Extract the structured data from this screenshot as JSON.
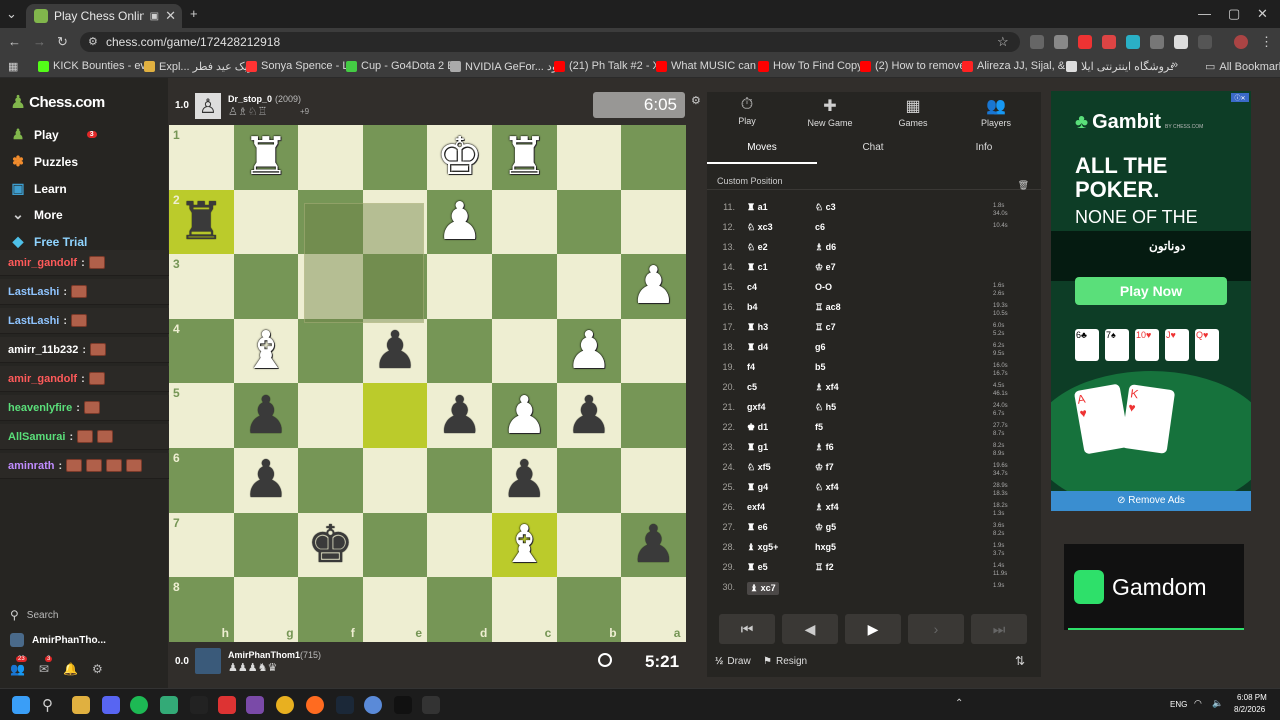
{
  "browser": {
    "tab_title": "Play Chess Online for FREE",
    "url": "chess.com/game/172428212918",
    "bookmarks": [
      {
        "label": "KICK Bounties - eve...",
        "color": "#53fc18"
      },
      {
        "label": "Expl... تبریک عید فطر",
        "color": "#e0b040"
      },
      {
        "label": "Sonya Spence - Let...",
        "color": "#ff3333"
      },
      {
        "label": "Cup - Go4Dota 2 Eu...",
        "color": "#44cc44"
      },
      {
        "label": "NVIDIA GeFor... دانلود",
        "color": "#aaaaaa"
      },
      {
        "label": "(21) Ph Talk #2 - XX...",
        "color": "#ff0000"
      },
      {
        "label": "What MUSIC can yo...",
        "color": "#ff0000"
      },
      {
        "label": "How To Find Copyri...",
        "color": "#ff0000"
      },
      {
        "label": "(2) How to remove...",
        "color": "#ff0000"
      },
      {
        "label": "Alireza JJ, Sijal, & N...",
        "color": "#ff2222"
      },
      {
        "label": "فروشگاه اینترنتی ایلا...",
        "color": "#dddddd"
      }
    ],
    "all_bookmarks": "All Bookmarks"
  },
  "sidebar": {
    "logo": "Chess.com",
    "nav": [
      {
        "label": "Play",
        "icon": "pawn-play-icon",
        "badge": "3"
      },
      {
        "label": "Puzzles",
        "icon": "puzzle-icon"
      },
      {
        "label": "Learn",
        "icon": "learn-icon"
      },
      {
        "label": "More",
        "icon": "chevron-down-icon"
      },
      {
        "label": "Free Trial",
        "icon": "diamond-icon"
      }
    ],
    "search": "Search",
    "user": "AmirPhanTho...",
    "notif_badges": [
      "23",
      "3"
    ]
  },
  "chat_overlay": [
    {
      "name": "amir_gandolf",
      "color": "#ff5a5a",
      "emotes": 1
    },
    {
      "name": "LastLashi",
      "color": "#8fc4ff",
      "emotes": 1
    },
    {
      "name": "LastLashi",
      "color": "#8fc4ff",
      "emotes": 1
    },
    {
      "name": "amirr_11b232",
      "color": "#ffffff",
      "emotes": 1
    },
    {
      "name": "amir_gandolf",
      "color": "#ff5a5a",
      "emotes": 1
    },
    {
      "name": "heavenlyfire",
      "color": "#5adf7a",
      "emotes": 1
    },
    {
      "name": "AllSamurai",
      "color": "#5adf7a",
      "emotes": 2
    },
    {
      "name": "aminrath",
      "color": "#c08cff",
      "emotes": 4
    }
  ],
  "top_player": {
    "eval": "1.0",
    "name": "Dr_stop_0",
    "rating": "(2009)",
    "captured_extra": "+9",
    "clock": "6:05"
  },
  "bottom_player": {
    "eval": "0.0",
    "name": "AmirPhanThom1",
    "rating": "(715)",
    "clock": "5:21"
  },
  "board": {
    "ranks": [
      "1",
      "2",
      "3",
      "4",
      "5",
      "6",
      "7",
      "8"
    ],
    "files": [
      "h",
      "g",
      "f",
      "e",
      "d",
      "c",
      "b",
      "a"
    ],
    "pieces": [
      {
        "r": 0,
        "c": 1,
        "p": "♜",
        "side": "w"
      },
      {
        "r": 0,
        "c": 4,
        "p": "♚",
        "side": "w"
      },
      {
        "r": 0,
        "c": 5,
        "p": "♜",
        "side": "w"
      },
      {
        "r": 1,
        "c": 0,
        "p": "♜",
        "side": "b"
      },
      {
        "r": 1,
        "c": 4,
        "p": "♟",
        "side": "w"
      },
      {
        "r": 2,
        "c": 7,
        "p": "♟",
        "side": "w"
      },
      {
        "r": 3,
        "c": 1,
        "p": "♝",
        "side": "w"
      },
      {
        "r": 3,
        "c": 3,
        "p": "♟",
        "side": "b"
      },
      {
        "r": 3,
        "c": 6,
        "p": "♟",
        "side": "w"
      },
      {
        "r": 4,
        "c": 1,
        "p": "♟",
        "side": "b"
      },
      {
        "r": 4,
        "c": 4,
        "p": "♟",
        "side": "b"
      },
      {
        "r": 4,
        "c": 5,
        "p": "♟",
        "side": "w"
      },
      {
        "r": 4,
        "c": 6,
        "p": "♟",
        "side": "b"
      },
      {
        "r": 5,
        "c": 1,
        "p": "♟",
        "side": "b"
      },
      {
        "r": 5,
        "c": 5,
        "p": "♟",
        "side": "b"
      },
      {
        "r": 6,
        "c": 2,
        "p": "♚",
        "side": "b"
      },
      {
        "r": 6,
        "c": 5,
        "p": "♝",
        "side": "w"
      },
      {
        "r": 6,
        "c": 7,
        "p": "♟",
        "side": "b"
      }
    ],
    "highlights": [
      {
        "r": 4,
        "c": 3
      },
      {
        "r": 6,
        "c": 5
      },
      {
        "r": 1,
        "c": 0
      }
    ]
  },
  "panel": {
    "tabs": [
      {
        "label": "Play",
        "icon": "stopwatch-icon"
      },
      {
        "label": "New Game",
        "icon": "plus-icon"
      },
      {
        "label": "Games",
        "icon": "board-icon"
      },
      {
        "label": "Players",
        "icon": "players-icon"
      }
    ],
    "subtabs": [
      "Moves",
      "Chat",
      "Info"
    ],
    "position_label": "Custom Position",
    "moves": [
      {
        "n": "11.",
        "w": "♜ a1",
        "b": "♘ c3",
        "t": "1.8s\n34.0s"
      },
      {
        "n": "12.",
        "w": "♘ xc3",
        "b": "c6",
        "t": "10.4s"
      },
      {
        "n": "13.",
        "w": "♘ e2",
        "b": "♗ d6",
        "t": ""
      },
      {
        "n": "14.",
        "w": "♜ c1",
        "b": "♔ e7",
        "t": ""
      },
      {
        "n": "15.",
        "w": "c4",
        "b": "O-O",
        "t": "1.6s\n2.6s"
      },
      {
        "n": "16.",
        "w": "b4",
        "b": "♖ ac8",
        "t": "19.3s\n10.5s"
      },
      {
        "n": "17.",
        "w": "♜ h3",
        "b": "♖ c7",
        "t": "6.0s\n5.2s"
      },
      {
        "n": "18.",
        "w": "♜ d4",
        "b": "g6",
        "t": "6.2s\n9.5s"
      },
      {
        "n": "19.",
        "w": "f4",
        "b": "b5",
        "t": "16.0s\n16.7s"
      },
      {
        "n": "20.",
        "w": "c5",
        "b": "♗ xf4",
        "t": "4.5s\n46.1s"
      },
      {
        "n": "21.",
        "w": "gxf4",
        "b": "♘ h5",
        "t": "24.0s\n6.7s"
      },
      {
        "n": "22.",
        "w": "♚ d1",
        "b": "f5",
        "t": "27.7s\n8.7s"
      },
      {
        "n": "23.",
        "w": "♜ g1",
        "b": "♗ f6",
        "t": "8.2s\n8.9s"
      },
      {
        "n": "24.",
        "w": "♘ xf5",
        "b": "♔ f7",
        "t": "19.6s\n34.7s"
      },
      {
        "n": "25.",
        "w": "♜ g4",
        "b": "♘ xf4",
        "t": "28.9s\n18.3s"
      },
      {
        "n": "26.",
        "w": "exf4",
        "b": "♗ xf4",
        "t": "18.2s\n1.3s"
      },
      {
        "n": "27.",
        "w": "♜ e6",
        "b": "♔ g5",
        "t": "3.6s\n8.2s"
      },
      {
        "n": "28.",
        "w": "♝ xg5+",
        "b": "hxg5",
        "t": "1.9s\n3.7s"
      },
      {
        "n": "29.",
        "w": "♜ e5",
        "b": "♖ f2",
        "t": "1.4s\n11.9s"
      },
      {
        "n": "30.",
        "w": "♝ xc7",
        "b": "",
        "t": "1.9s"
      }
    ],
    "draw": "Draw",
    "resign": "Resign"
  },
  "ads": {
    "gambit_brand": "Gambit",
    "gambit_by": "BY CHESS.COM",
    "gambit_headline": [
      "ALL THE",
      "POKER.",
      "NONE OF THE"
    ],
    "arabic_text": "دوناتون",
    "gambit_cta": "Play Now",
    "remove_ads": "Remove Ads",
    "gamdom": "Gamdom"
  },
  "taskbar": {
    "lang": "ENG",
    "time": "6:08 PM",
    "date": "8/2/2026"
  }
}
